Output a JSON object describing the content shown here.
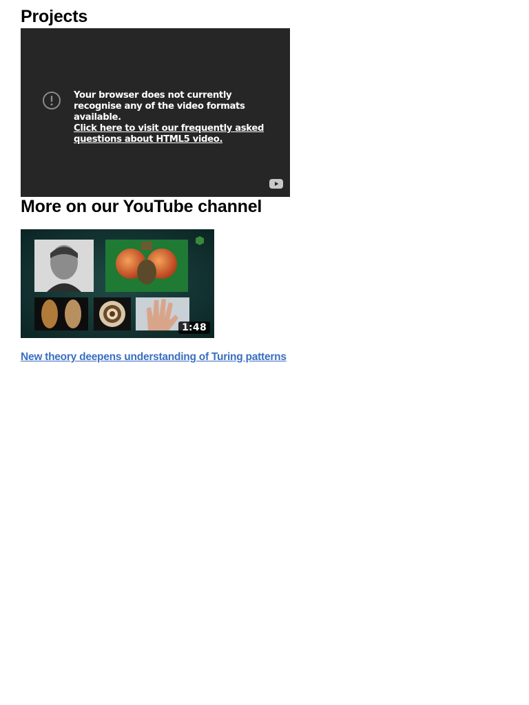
{
  "projects": {
    "title": "Projects"
  },
  "video_player": {
    "error_message": "Your browser does not currently recognise any of the video formats available.",
    "faq_link": "Click here to visit our frequently asked questions about HTML5 video.",
    "warning_icon": "exclamation-circle-icon",
    "fullscreen_icon": "youtube-icon"
  },
  "youtube": {
    "title": "More on our YouTube channel",
    "video": {
      "duration": "1:48",
      "link_text": "New theory deepens understanding of Turing patterns"
    }
  }
}
